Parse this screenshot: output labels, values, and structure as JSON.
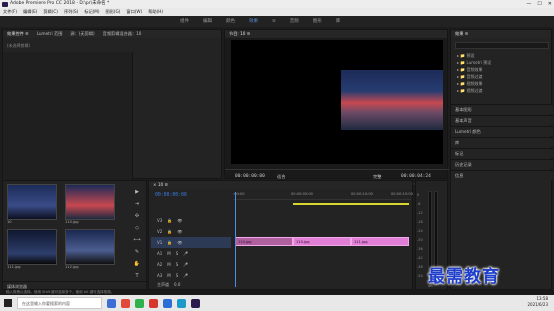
{
  "title": "Adobe Premiere Pro CC 2018 - D:\\pr\\未命名 *",
  "window_controls": [
    "—",
    "☐",
    "✕"
  ],
  "menu": [
    "文件(F)",
    "编辑(E)",
    "剪辑(C)",
    "序列(S)",
    "标记(M)",
    "图形(G)",
    "窗口(W)",
    "帮助(H)"
  ],
  "workspace_tabs": [
    {
      "label": "组件",
      "active": false
    },
    {
      "label": "编辑",
      "active": false
    },
    {
      "label": "颜色",
      "active": false
    },
    {
      "label": "效果",
      "active": true
    },
    {
      "label": "≡",
      "active": false
    },
    {
      "label": "音频",
      "active": false
    },
    {
      "label": "图形",
      "active": false
    },
    {
      "label": "库",
      "active": false
    }
  ],
  "source_panel": {
    "tabs": [
      "效果控件 ≡",
      "Lumetri 范围",
      "源：(无剪辑)",
      "音频剪辑混合器：10"
    ],
    "subtitle": "(未选择剪辑)"
  },
  "program": {
    "title": "节目: 10 ≡",
    "timecode_left": "00:00:00:00",
    "fit": "适合",
    "quality": "完整",
    "timecode_right": "00:00:04:24",
    "controls": [
      "▼",
      "{",
      "}",
      "|←",
      "◀|",
      "▶",
      "|▶",
      "→|",
      "⊞",
      "⊟",
      "📷",
      "+"
    ]
  },
  "effects": {
    "title": "效果 ≡",
    "search_placeholder": "",
    "tree": [
      "▸ 📁 预设",
      "▸ 📁 Lumetri 预设",
      "▸ 📁 音频效果",
      "▸ 📁 音频过渡",
      "▸ 📁 视频效果",
      "▸ 📁 视频过渡"
    ],
    "sections": [
      "基本图形",
      "基本声音",
      "Lumetri 颜色",
      "库",
      "标记",
      "历史记录",
      "信息"
    ]
  },
  "project": {
    "items": [
      {
        "name": "10",
        "duration": "4:24"
      },
      {
        "name": "110.jpg",
        "duration": "4:29"
      },
      {
        "name": "111.jpg",
        "duration": "4:29"
      },
      {
        "name": "112.jpg",
        "duration": "4:29"
      }
    ],
    "footer": "媒体浏览器"
  },
  "timeline": {
    "title": "× 10 ≡",
    "timecode": "00:00:00:00",
    "ruler": [
      ":00:00",
      "00:00:05:00",
      "00:00:10:00",
      "00:00:15:00"
    ],
    "video_tracks": [
      "V3",
      "V2",
      "V1"
    ],
    "audio_tracks": [
      "A1",
      "A2",
      "A3"
    ],
    "master": "主声道",
    "master_value": "0.0",
    "clips": [
      "110.jpg",
      "110.jpg",
      "111.jpg"
    ]
  },
  "meter": {
    "ticks": [
      "0",
      "-6",
      "-12",
      "-18",
      "-24",
      "-30",
      "-36",
      "-42",
      "-48",
      "-54"
    ],
    "unit": "dB"
  },
  "status_text": "输入拖拽以选择。使用 Shift 键可选择多个，使用 Alt 键可选择视频。",
  "watermark": "最需教育",
  "taskbar": {
    "search_placeholder": "在这里输入你要搜索的内容",
    "time": "13:58",
    "date": "2021/6/23"
  }
}
